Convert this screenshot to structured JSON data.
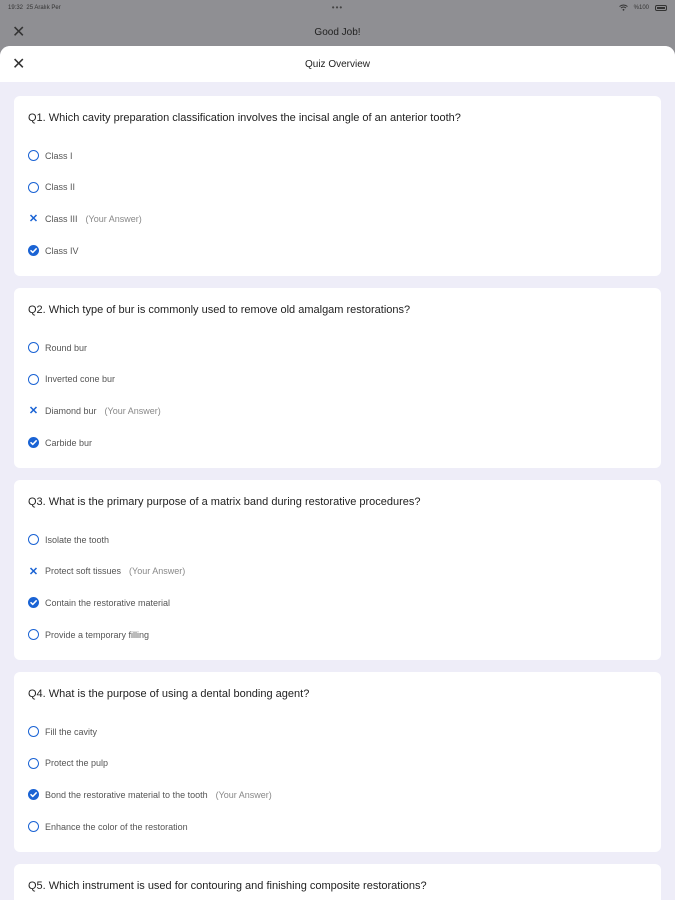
{
  "status": {
    "time": "19:32",
    "date": "25 Aralık Per",
    "dots": "•••",
    "battery": "%100"
  },
  "background": {
    "title": "Good Job!"
  },
  "sheet": {
    "title": "Quiz Overview"
  },
  "your_answer_label": "(Your Answer)",
  "questions": [
    {
      "text": "Q1. Which cavity preparation classification involves the incisal angle of an anterior tooth?",
      "options": [
        {
          "label": "Class I",
          "state": "unselected"
        },
        {
          "label": "Class II",
          "state": "unselected"
        },
        {
          "label": "Class III",
          "state": "wrong"
        },
        {
          "label": "Class IV",
          "state": "correct"
        }
      ]
    },
    {
      "text": "Q2. Which type of bur is commonly used to remove old amalgam restorations?",
      "options": [
        {
          "label": "Round bur",
          "state": "unselected"
        },
        {
          "label": "Inverted cone bur",
          "state": "unselected"
        },
        {
          "label": "Diamond bur",
          "state": "wrong"
        },
        {
          "label": "Carbide bur",
          "state": "correct"
        }
      ]
    },
    {
      "text": "Q3. What is the primary purpose of a matrix band during restorative procedures?",
      "options": [
        {
          "label": "Isolate the tooth",
          "state": "unselected"
        },
        {
          "label": "Protect soft tissues",
          "state": "wrong"
        },
        {
          "label": "Contain the restorative material",
          "state": "correct"
        },
        {
          "label": "Provide a temporary filling",
          "state": "unselected"
        }
      ]
    },
    {
      "text": "Q4. What is the purpose of using a dental bonding agent?",
      "options": [
        {
          "label": "Fill the cavity",
          "state": "unselected"
        },
        {
          "label": "Protect the pulp",
          "state": "unselected"
        },
        {
          "label": "Bond the restorative material to the tooth",
          "state": "correct-chosen"
        },
        {
          "label": "Enhance the color of the restoration",
          "state": "unselected"
        }
      ]
    },
    {
      "text": "Q5. Which instrument is used for contouring and finishing composite restorations?",
      "options": []
    }
  ]
}
